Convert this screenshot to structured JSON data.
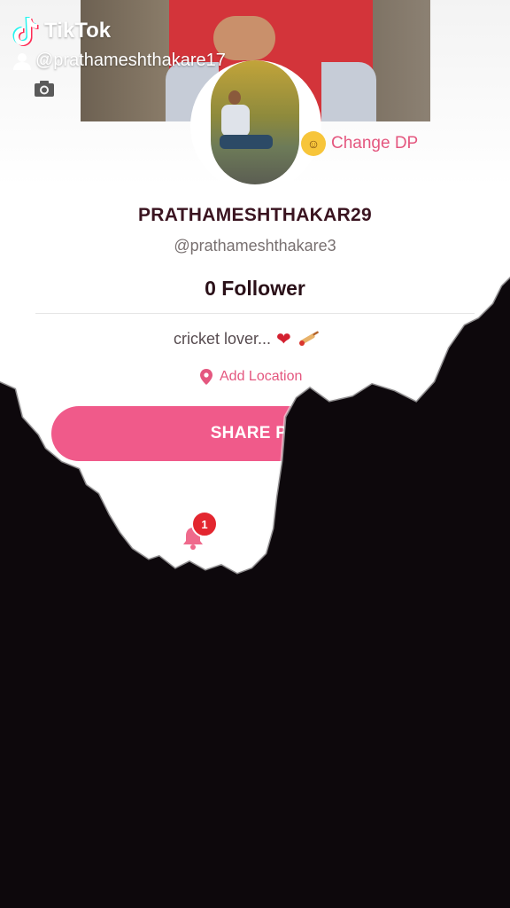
{
  "watermark": {
    "app_name": "TikTok",
    "creator_handle": "@prathameshthakare17"
  },
  "profile": {
    "change_dp_label": "Change DP",
    "display_name": "PRATHAMESHTHAKAR29",
    "handle": "@prathameshthakare3",
    "follower_text": "0 Follower",
    "bio_text": "cricket lover...",
    "location_label": "Add Location",
    "share_label": "SHARE PR",
    "notification_count": "1"
  },
  "colors": {
    "accent_pink": "#f05a8a",
    "text_pink": "#e4577f",
    "badge_red": "#e3262f",
    "background_dark": "#0d080c"
  },
  "icons": {
    "camera": "camera-icon",
    "emoji": "kissing-face-icon",
    "location": "map-pin-icon",
    "bell": "bell-icon",
    "heart": "heart-icon",
    "cricket": "cricket-bat-icon",
    "user": "user-icon",
    "logo": "tiktok-note-icon"
  }
}
